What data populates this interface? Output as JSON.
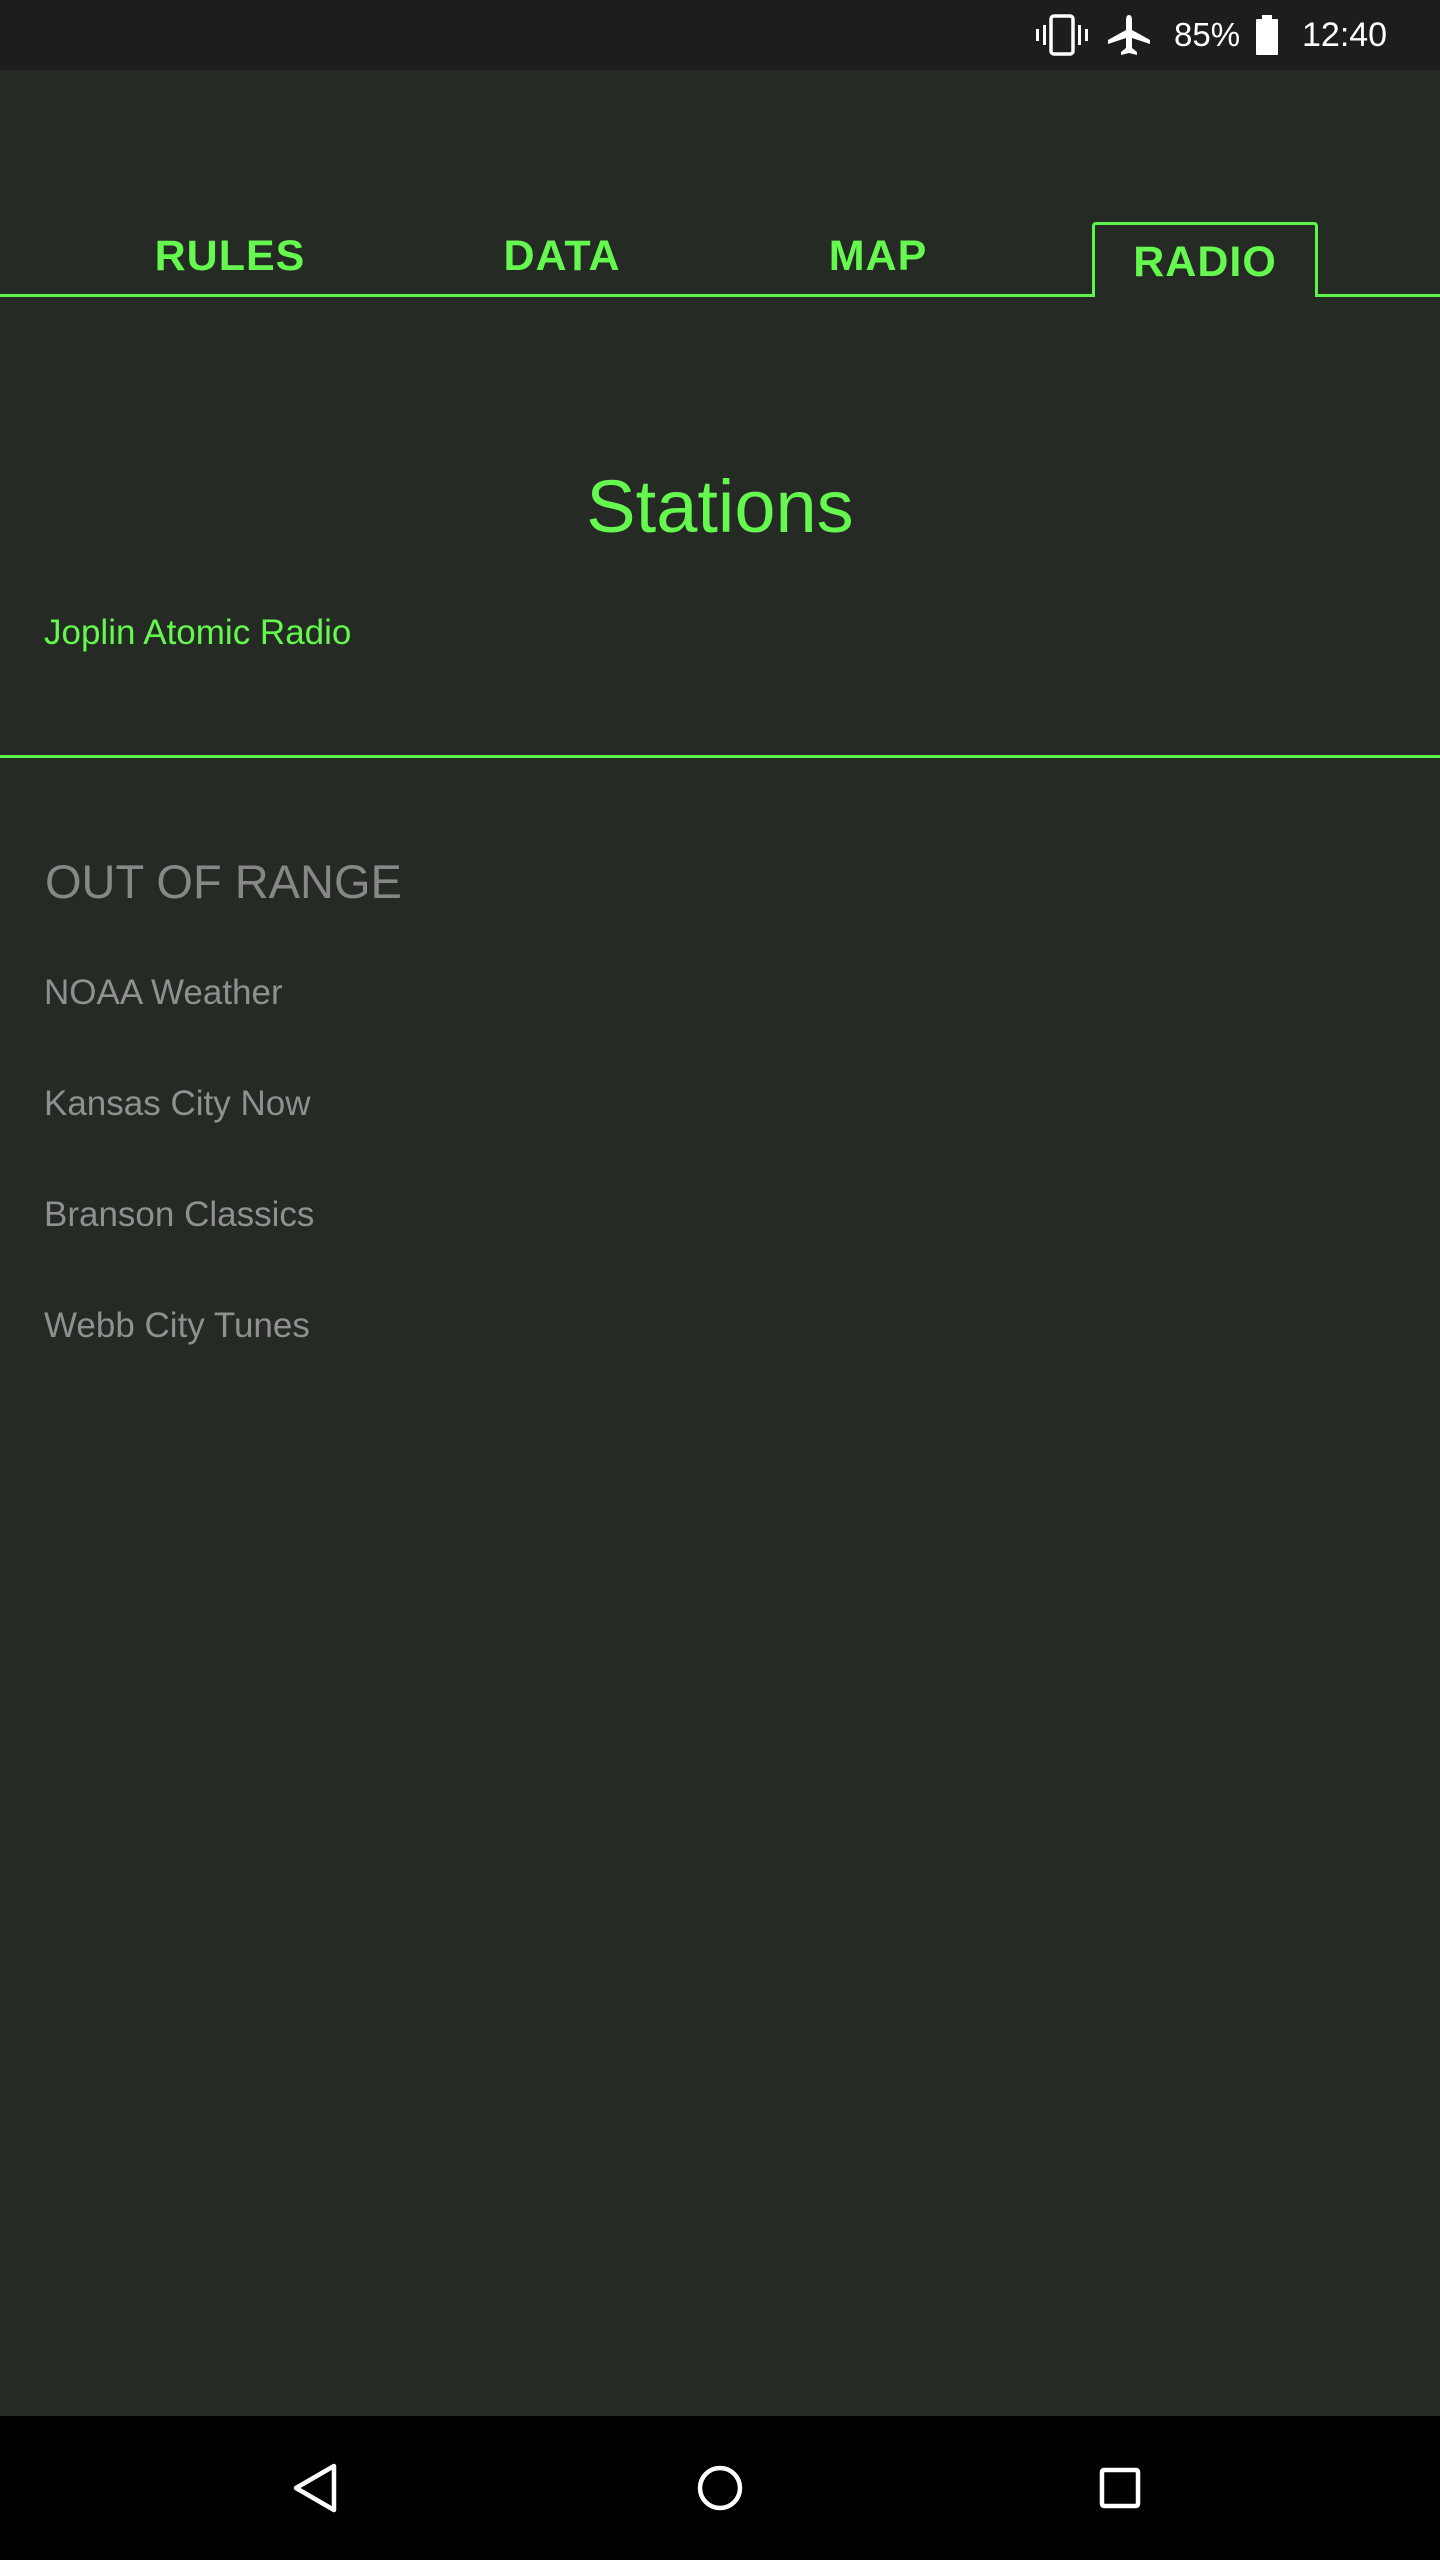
{
  "status_bar": {
    "battery_percent": "85%",
    "time": "12:40",
    "icons": [
      "vibrate-icon",
      "airplane-mode-icon",
      "battery-icon"
    ]
  },
  "tabs": [
    {
      "label": "RULES",
      "active": false
    },
    {
      "label": "DATA",
      "active": false
    },
    {
      "label": "MAP",
      "active": false
    },
    {
      "label": "RADIO",
      "active": true
    }
  ],
  "stations": {
    "title": "Stations",
    "in_range": [
      "Joplin Atomic Radio"
    ]
  },
  "out_of_range": {
    "heading": "OUT OF RANGE",
    "items": [
      "NOAA Weather",
      "Kansas City Now",
      "Branson Classics",
      "Webb City Tunes"
    ]
  },
  "nav_bar": {
    "icons": [
      "back-icon",
      "home-icon",
      "recent-apps-icon"
    ]
  },
  "colors": {
    "accent": "#65f84f",
    "background": "#252a25",
    "muted_text": "#8e918e",
    "status_bar_bg": "#1b1e1b",
    "nav_bar_bg": "#000000"
  }
}
